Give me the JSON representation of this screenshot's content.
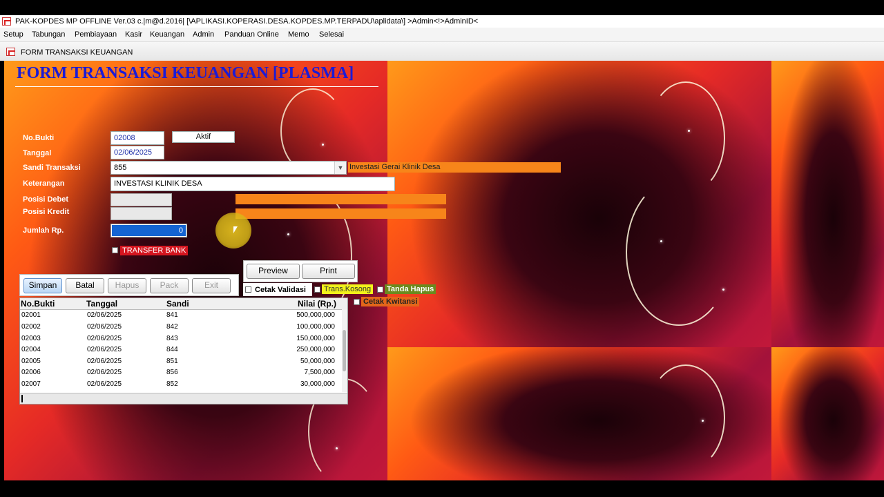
{
  "window": {
    "title": "PAK-KOPDES MP OFFLINE Ver.03 c.|m@d.2016| [\\APLIKASI.KOPERASI.DESA.KOPDES.MP.TERPADU\\aplidata\\] >Admin<!>AdminID<"
  },
  "menu": [
    "Setup",
    "Tabungan",
    "Pembiayaan",
    "Kasir",
    "Keuangan",
    "Admin",
    "Panduan Online",
    "Memo",
    "Selesai"
  ],
  "subwindow": {
    "title": "FORM TRANSAKSI KEUANGAN"
  },
  "form": {
    "heading": "FORM TRANSAKSI KEUANGAN [PLASMA]",
    "labels": {
      "no_bukti": "No.Bukti",
      "tanggal": "Tanggal",
      "sandi": "Sandi Transaksi",
      "keterangan": "Keterangan",
      "posisi_debet": "Posisi Debet",
      "posisi_kredit": "Posisi Kredit",
      "jumlah": "Jumlah Rp."
    },
    "values": {
      "no_bukti": "02008",
      "status": "Aktif",
      "tanggal": "02/06/2025",
      "sandi": "855",
      "sandi_desc": "Investasi Gerai Klinik Desa",
      "keterangan": "INVESTASI KLINIK DESA",
      "posisi_debet": "",
      "posisi_kredit": "",
      "jumlah": "0"
    },
    "transfer_bank": "TRANSFER BANK"
  },
  "buttons": {
    "simpan": "Simpan",
    "batal": "Batal",
    "hapus": "Hapus",
    "pack": "Pack",
    "exit": "Exit",
    "preview": "Preview",
    "print": "Print"
  },
  "options": {
    "cetak_validasi": "Cetak Validasi",
    "trans_kosong": "Trans.Kosong",
    "tanda_hapus": "Tanda Hapus",
    "cetak_kwitansi": "Cetak Kwitansi"
  },
  "table": {
    "columns": [
      "No.Bukti",
      "Tanggal",
      "Sandi",
      "Nilai (Rp.)"
    ],
    "rows": [
      [
        "02001",
        "02/06/2025",
        "841",
        "500,000,000"
      ],
      [
        "02002",
        "02/06/2025",
        "842",
        "100,000,000"
      ],
      [
        "02003",
        "02/06/2025",
        "843",
        "150,000,000"
      ],
      [
        "02004",
        "02/06/2025",
        "844",
        "250,000,000"
      ],
      [
        "02005",
        "02/06/2025",
        "851",
        "50,000,000"
      ],
      [
        "02006",
        "02/06/2025",
        "856",
        "7,500,000"
      ],
      [
        "02007",
        "02/06/2025",
        "852",
        "30,000,000"
      ]
    ]
  },
  "colors": {
    "heading": "#1b1bd6",
    "orange_bar": "#f7851a",
    "transfer_bank_bg": "#d4151f",
    "trans_kosong_bg": "#f2f21a",
    "tanda_hapus_bg": "#6b8a1e",
    "cetak_kwitansi_bg": "#e4661a",
    "jumlah_field": "#1464d2"
  }
}
